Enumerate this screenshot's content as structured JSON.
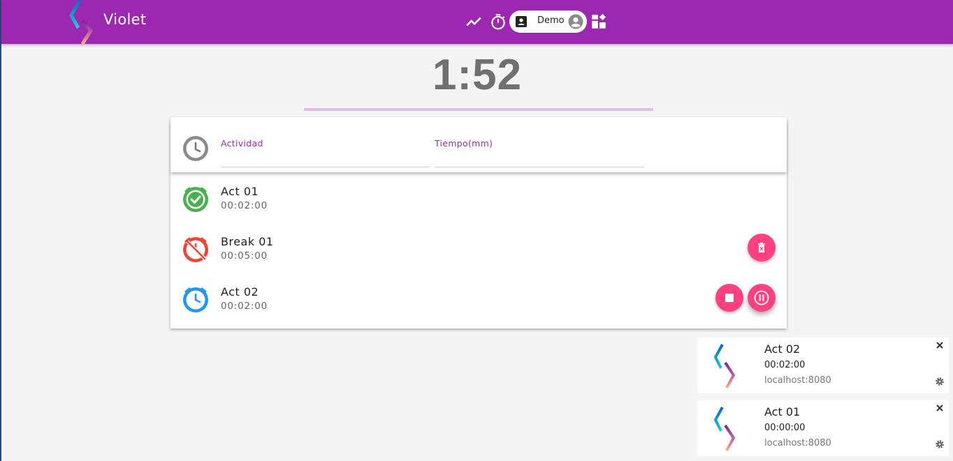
{
  "app": {
    "title": "Violet"
  },
  "header": {
    "icons": [
      "chart-line-icon",
      "timer-icon",
      "contact-icon",
      "account-circle-icon",
      "dashboard-icon"
    ],
    "user": {
      "name": "Demo"
    }
  },
  "timer": {
    "display": "1:52",
    "progress": 0.0
  },
  "form": {
    "activity_label": "Actividad",
    "activity_value": "",
    "time_label": "Tiempo(mm)",
    "time_value": ""
  },
  "activities": [
    {
      "name": "Act 01",
      "time": "00:02:00",
      "status": "completed",
      "color": "#4caf50",
      "icon": "check-clock-icon"
    },
    {
      "name": "Break 01",
      "time": "00:05:00",
      "status": "cancelled",
      "color": "#f44336",
      "icon": "clock-off-icon",
      "actions": [
        "delete"
      ]
    },
    {
      "name": "Act 02",
      "time": "00:02:00",
      "status": "running",
      "color": "#2196f3",
      "icon": "clock-icon",
      "actions": [
        "stop",
        "pause"
      ]
    }
  ],
  "colors": {
    "primary": "#9c27b0",
    "accent": "#ff4081",
    "timer_bar": "#e1bee7"
  },
  "notifications": [
    {
      "title": "Act 02",
      "body": "00:02:00",
      "host": "localhost:8080"
    },
    {
      "title": "Act 01",
      "body": "00:00:00",
      "host": "localhost:8080"
    }
  ]
}
